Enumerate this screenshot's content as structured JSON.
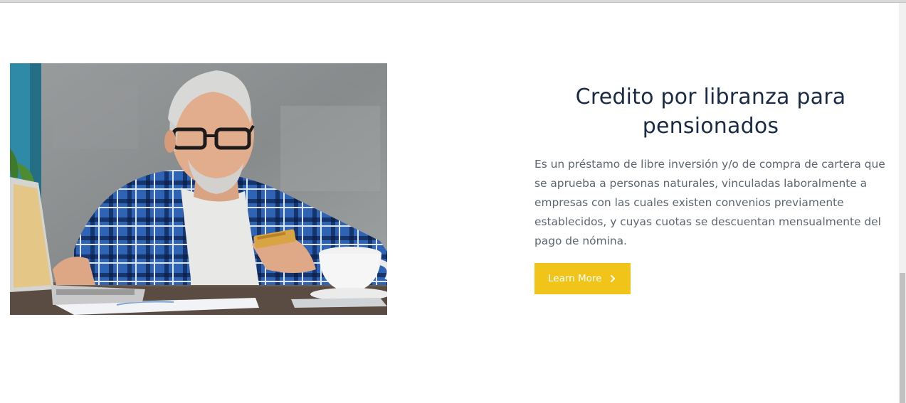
{
  "section": {
    "title": "Credito por libranza para pensionados",
    "description": "Es un préstamo de libre inversión y/o de compra de cartera que se aprueba a personas naturales, vinculadas laboralmente a empresas con las cuales existen convenios previamente establecidos, y cuyas cuotas se descuentan mensualmente del pago de nómina.",
    "cta_label": "Learn More",
    "cta_icon": "chevron-right-icon"
  },
  "photo": {
    "subject": "senior-man-with-laptop-and-card"
  },
  "colors": {
    "title": "#1a2a44",
    "body": "#5c6570",
    "cta_bg": "#f0c419",
    "cta_text": "#ffffff"
  }
}
